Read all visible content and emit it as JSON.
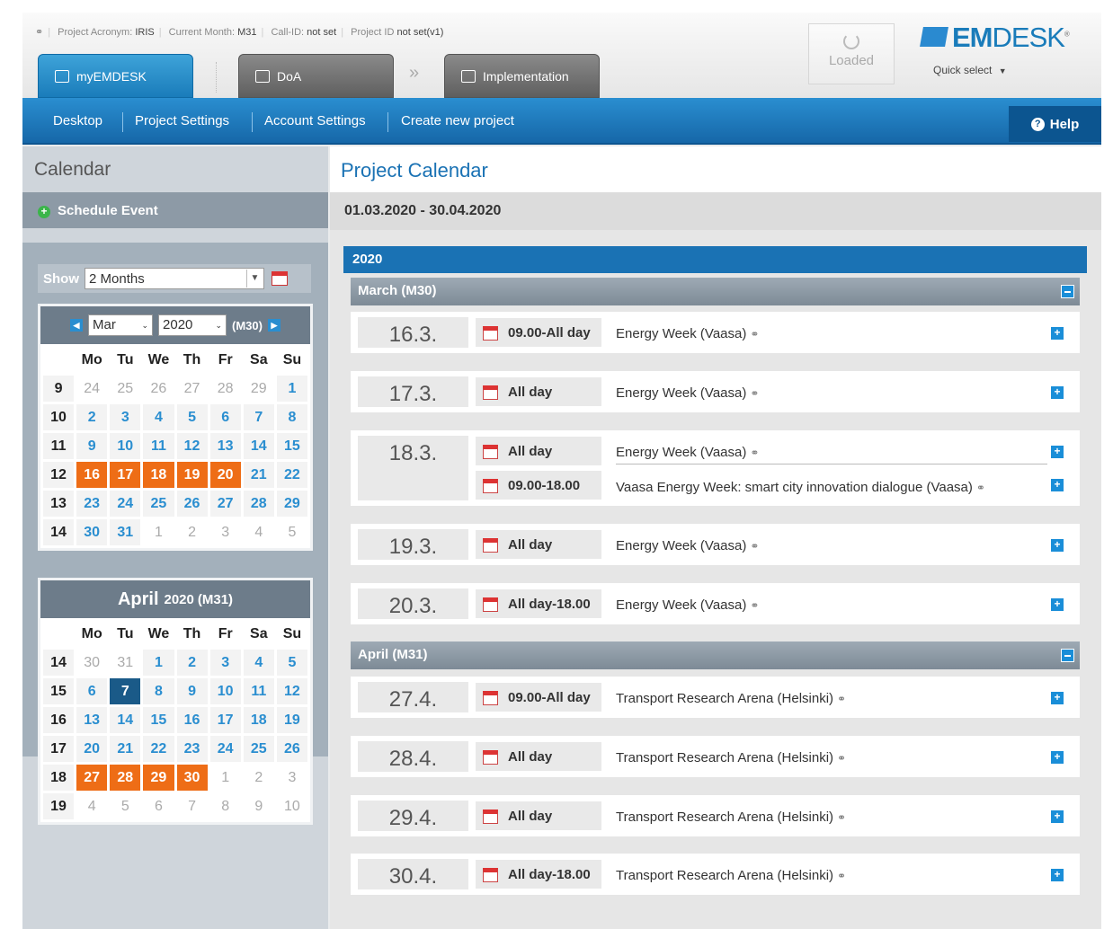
{
  "header": {
    "project_acronym_label": "Project Acronym:",
    "project_acronym": "IRIS",
    "current_month_label": "Current Month:",
    "current_month": "M31",
    "call_id_label": "Call-ID:",
    "call_id": "not set",
    "project_id_label": "Project ID",
    "project_id": "not set(v1)",
    "tabs": [
      "myEMDESK",
      "DoA",
      "Implementation"
    ],
    "loaded": "Loaded",
    "logo_bold": "EM",
    "logo_light": "DESK",
    "quick_select": "Quick select"
  },
  "nav": {
    "items": [
      "Desktop",
      "Project Settings",
      "Account Settings",
      "Create new project"
    ],
    "help": "Help"
  },
  "left": {
    "title": "Calendar",
    "schedule": "Schedule Event",
    "show_label": "Show",
    "show_value": "2 Months",
    "cal1": {
      "month": "Mar",
      "year": "2020",
      "mcode": "(M30)"
    },
    "cal2": {
      "month": "April",
      "year": "2020",
      "mcode": "(M31)"
    },
    "weekdays": [
      "Mo",
      "Tu",
      "We",
      "Th",
      "Fr",
      "Sa",
      "Su"
    ]
  },
  "main": {
    "title": "Project Calendar",
    "range": "01.03.2020 - 30.04.2020",
    "year": "2020",
    "months": [
      "March (M30)",
      "April (M31)"
    ],
    "rows": [
      {
        "date": "16.3.",
        "time": "09.00-All day",
        "title": "Energy Week (Vaasa)"
      },
      {
        "date": "17.3.",
        "time": "All day",
        "title": "Energy Week (Vaasa)"
      },
      {
        "date": "18.3.",
        "time": "All day",
        "title": "Energy Week (Vaasa)"
      },
      {
        "date": "",
        "time": "09.00-18.00",
        "title": "Vaasa Energy Week: smart city innovation dialogue (Vaasa)"
      },
      {
        "date": "19.3.",
        "time": "All day",
        "title": "Energy Week (Vaasa)"
      },
      {
        "date": "20.3.",
        "time": "All day-18.00",
        "title": "Energy Week (Vaasa)"
      },
      {
        "date": "27.4.",
        "time": "09.00-All day",
        "title": "Transport Research Arena (Helsinki)"
      },
      {
        "date": "28.4.",
        "time": "All day",
        "title": "Transport Research Arena (Helsinki)"
      },
      {
        "date": "29.4.",
        "time": "All day",
        "title": "Transport Research Arena (Helsinki)"
      },
      {
        "date": "30.4.",
        "time": "All day-18.00",
        "title": "Transport Research Arena (Helsinki)"
      }
    ]
  },
  "colors": {
    "accent": "#1a72b4",
    "event": "#ee6d16",
    "selected": "#1a5a88"
  }
}
